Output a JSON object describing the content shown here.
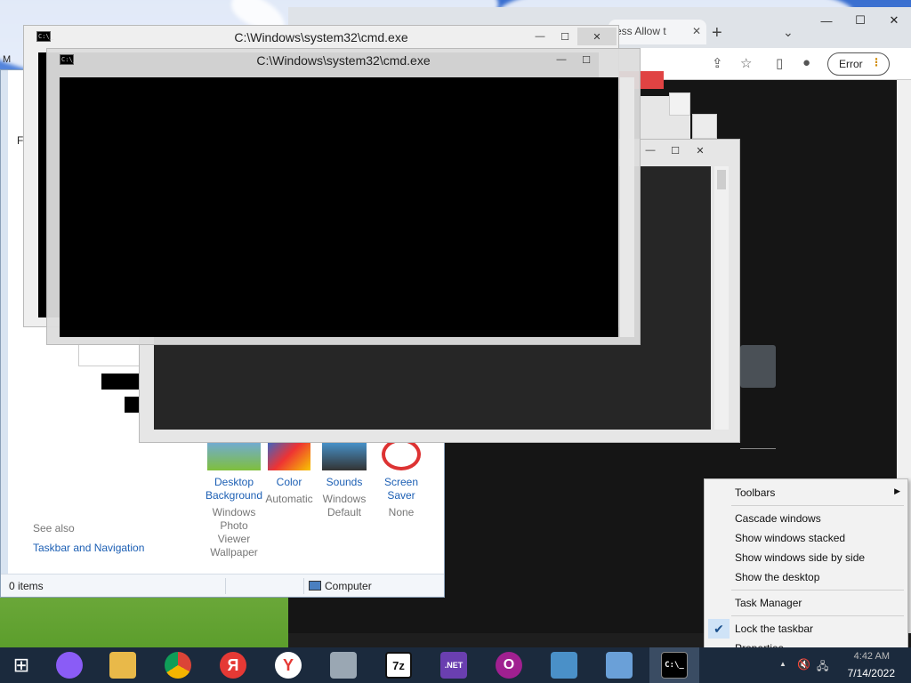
{
  "chrome": {
    "tab_title": "ess Allow t",
    "tab_close": "✕",
    "new_tab": "+",
    "tab_menu": "⌄",
    "minimize": "—",
    "maximize": "☐",
    "close": "✕",
    "error_label": "Error",
    "error_menu": "⋮"
  },
  "cmd_windows": [
    {
      "title": "C:\\Windows\\system32\\cmd.exe",
      "icon_text": "C:\\_"
    },
    {
      "title": "C:\\Windows\\system32\\cmd.exe",
      "icon_text": "C:\\_"
    }
  ],
  "window_buttons": {
    "minimize": "—",
    "maximize": "☐",
    "close": "✕"
  },
  "control_panel": {
    "left_labels": [
      "M",
      "Fi"
    ],
    "items": [
      {
        "label": "Desktop Background",
        "sub": "Windows Photo Viewer Wallpaper"
      },
      {
        "label": "Color",
        "sub": "Automatic"
      },
      {
        "label": "Sounds",
        "sub": "Windows Default"
      },
      {
        "label": "Screen Saver",
        "sub": "None"
      }
    ],
    "see_also": "See also",
    "see_also_link": "Taskbar and Navigation",
    "status_items": "0 items",
    "status_location": "Computer"
  },
  "context_menu": {
    "toolbars": "Toolbars",
    "cascade": "Cascade windows",
    "stacked": "Show windows stacked",
    "side_by_side": "Show windows side by side",
    "show_desktop": "Show the desktop",
    "task_manager": "Task Manager",
    "lock_taskbar": "Lock the taskbar",
    "lock_checked": true,
    "properties": "Properties"
  },
  "taskbar": {
    "apps": [
      {
        "name": "start",
        "glyph": "⊞",
        "color": "#1b2a3d"
      },
      {
        "name": "alice",
        "glyph": "",
        "color": "#8a5cf6"
      },
      {
        "name": "file-explorer",
        "glyph": "",
        "color": "#e9b949"
      },
      {
        "name": "chrome",
        "glyph": "",
        "color": "#db4437"
      },
      {
        "name": "yandex-browser",
        "glyph": "Я",
        "color": "#e53935"
      },
      {
        "name": "yandex",
        "glyph": "Y",
        "color": "#ffffff"
      },
      {
        "name": "recycle-bin",
        "glyph": "",
        "color": "#9aa7b3"
      },
      {
        "name": "7zip",
        "glyph": "7z",
        "color": "#111111"
      },
      {
        "name": "dotnet-tool",
        "glyph": ".NET",
        "color": "#6a3fb0"
      },
      {
        "name": "opera",
        "glyph": "O",
        "color": "#a02090"
      },
      {
        "name": "photo-viewer",
        "glyph": "",
        "color": "#4a90c8"
      },
      {
        "name": "control-panel",
        "glyph": "",
        "color": "#6aa0d8"
      },
      {
        "name": "cmd",
        "glyph": "C:\\_",
        "color": "#000000"
      }
    ],
    "time": "4:42 AM",
    "date": "7/14/2022",
    "tray_up": "▲",
    "tray_volume": "🔇",
    "tray_network": "🖧"
  }
}
